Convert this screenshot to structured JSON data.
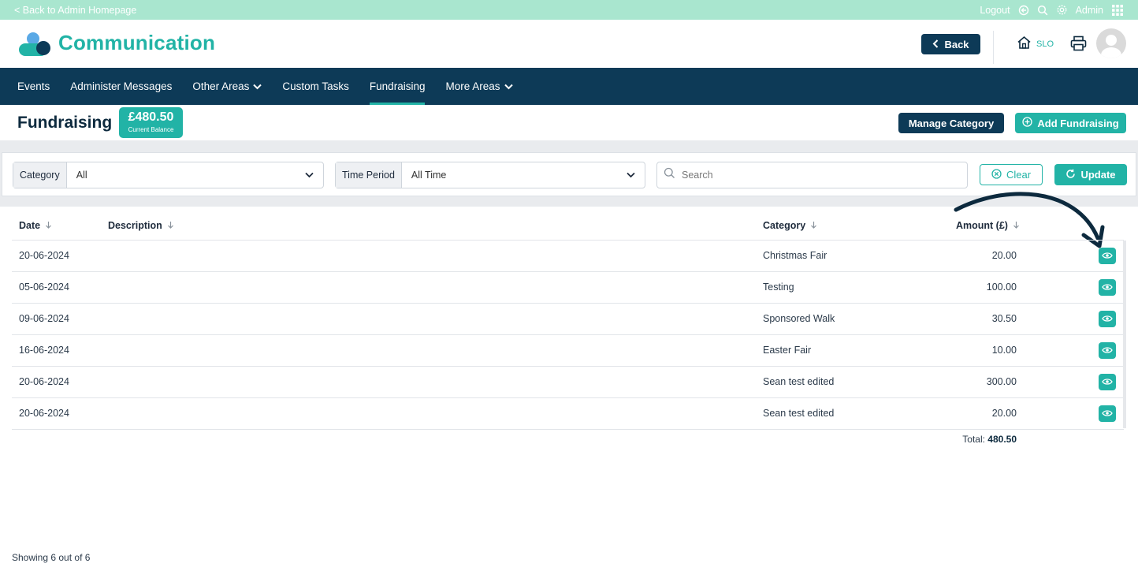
{
  "topbar": {
    "back_label": "< Back to Admin Homepage",
    "logout_label": "Logout",
    "user_label": "Admin"
  },
  "header": {
    "app_title": "Communication",
    "back_button": "Back",
    "school_code": "SLO"
  },
  "nav": {
    "items": [
      {
        "label": "Events",
        "dropdown": false,
        "active": false
      },
      {
        "label": "Administer Messages",
        "dropdown": false,
        "active": false
      },
      {
        "label": "Other Areas",
        "dropdown": true,
        "active": false
      },
      {
        "label": "Custom Tasks",
        "dropdown": false,
        "active": false
      },
      {
        "label": "Fundraising",
        "dropdown": false,
        "active": true
      },
      {
        "label": "More Areas",
        "dropdown": true,
        "active": false
      }
    ]
  },
  "page": {
    "title": "Fundraising",
    "balance_amount": "£480.50",
    "balance_label": "Current Balance",
    "manage_button": "Manage Category",
    "add_button": "Add Fundraising"
  },
  "filters": {
    "category_label": "Category",
    "category_value": "All",
    "period_label": "Time Period",
    "period_value": "All Time",
    "search_placeholder": "Search",
    "clear_label": "Clear",
    "update_label": "Update"
  },
  "table": {
    "columns": {
      "date": "Date",
      "description": "Description",
      "category": "Category",
      "amount": "Amount (£)"
    },
    "rows": [
      {
        "date": "20-06-2024",
        "description": "",
        "category": "Christmas Fair",
        "amount": "20.00"
      },
      {
        "date": "05-06-2024",
        "description": "",
        "category": "Testing",
        "amount": "100.00"
      },
      {
        "date": "09-06-2024",
        "description": "",
        "category": "Sponsored Walk",
        "amount": "30.50"
      },
      {
        "date": "16-06-2024",
        "description": "",
        "category": "Easter Fair",
        "amount": "10.00"
      },
      {
        "date": "20-06-2024",
        "description": "",
        "category": "Sean test edited",
        "amount": "300.00"
      },
      {
        "date": "20-06-2024",
        "description": "",
        "category": "Sean test edited",
        "amount": "20.00"
      }
    ],
    "total_label": "Total:",
    "total_value": "480.50"
  },
  "footer": {
    "showing": "Showing 6 out of 6"
  },
  "colors": {
    "teal": "#22b3a6",
    "navy": "#0d3a57",
    "mint": "#a9e6cf"
  }
}
